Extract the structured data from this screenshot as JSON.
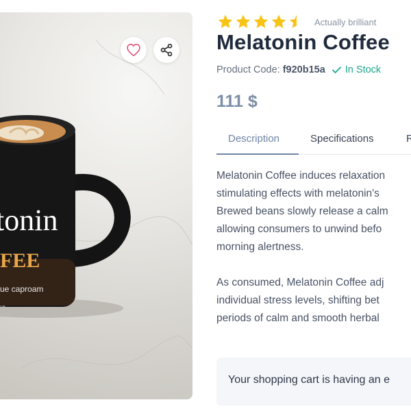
{
  "product": {
    "title": "Melatonin Coffee",
    "rating": 4.5,
    "rating_max": 5,
    "rating_text": "Actually brilliant",
    "code_label": "Product Code:",
    "code_value": "f920b15a",
    "stock_text": "In Stock",
    "price": "111 $",
    "image": {
      "mug_label_line1": "tonin",
      "mug_label_line2": "FEE",
      "mug_label_line3": "ue caproam",
      "mug_small_1": "ue",
      "mug_small_2": "g)"
    }
  },
  "actions": {
    "wishlist_icon": "heart-icon",
    "share_icon": "share-icon"
  },
  "tabs": [
    {
      "label": "Description",
      "active": true
    },
    {
      "label": "Specifications",
      "active": false
    },
    {
      "label": "R",
      "active": false
    }
  ],
  "description": {
    "paragraph1": [
      "Melatonin Coffee induces relaxation",
      "stimulating effects with melatonin's",
      "Brewed beans slowly release a calm",
      "allowing consumers to unwind befo",
      "morning alertness."
    ],
    "paragraph2": [
      "As consumed, Melatonin Coffee adj",
      "individual stress levels, shifting bet",
      "periods of calm and smooth herbal"
    ]
  },
  "cart": {
    "message": "Your shopping cart is having an e"
  },
  "colors": {
    "star": "#f8c315",
    "accent": "#6f84a5",
    "in_stock": "#1aa68c",
    "wishlist": "#e0567a"
  }
}
